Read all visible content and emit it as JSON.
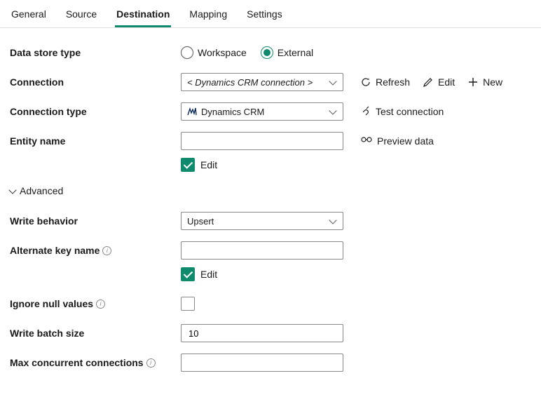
{
  "tabs": {
    "general": "General",
    "source": "Source",
    "destination": "Destination",
    "mapping": "Mapping",
    "settings": "Settings"
  },
  "labels": {
    "data_store_type": "Data store type",
    "connection": "Connection",
    "connection_type": "Connection type",
    "entity_name": "Entity name",
    "advanced": "Advanced",
    "write_behavior": "Write behavior",
    "alternate_key_name": "Alternate key name",
    "ignore_null_values": "Ignore null values",
    "write_batch_size": "Write batch size",
    "max_concurrent_connections": "Max concurrent connections"
  },
  "radio": {
    "workspace": "Workspace",
    "external": "External"
  },
  "selects": {
    "connection_placeholder": "< Dynamics CRM connection >",
    "connection_type_value": "Dynamics CRM",
    "write_behavior_value": "Upsert"
  },
  "inputs": {
    "entity_name": "",
    "alternate_key_name": "",
    "write_batch_size": "10",
    "max_concurrent_connections": ""
  },
  "edit_checkbox_label": "Edit",
  "actions": {
    "refresh": "Refresh",
    "edit": "Edit",
    "new": "New",
    "test_connection": "Test connection",
    "preview_data": "Preview data"
  }
}
